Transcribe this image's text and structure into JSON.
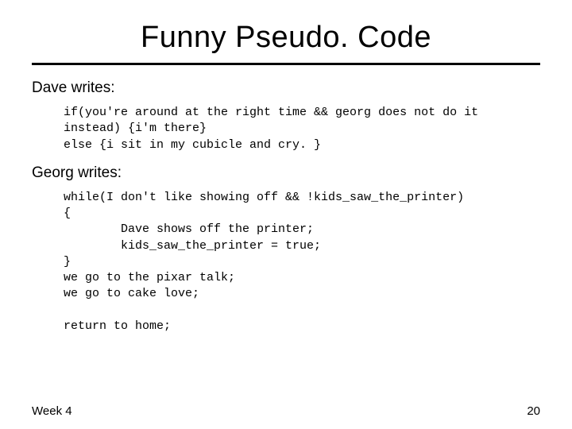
{
  "title": "Funny Pseudo. Code",
  "dave_label": "Dave writes:",
  "dave_code": "if(you're around at the right time && georg does not do it\ninstead) {i'm there}\nelse {i sit in my cubicle and cry. }",
  "georg_label": "Georg writes:",
  "georg_code": "while(I don't like showing off && !kids_saw_the_printer)\n{\n        Dave shows off the printer;\n        kids_saw_the_printer = true;\n}\nwe go to the pixar talk;\nwe go to cake love;\n\nreturn to home;",
  "footer_left": "Week 4",
  "footer_right": "20"
}
